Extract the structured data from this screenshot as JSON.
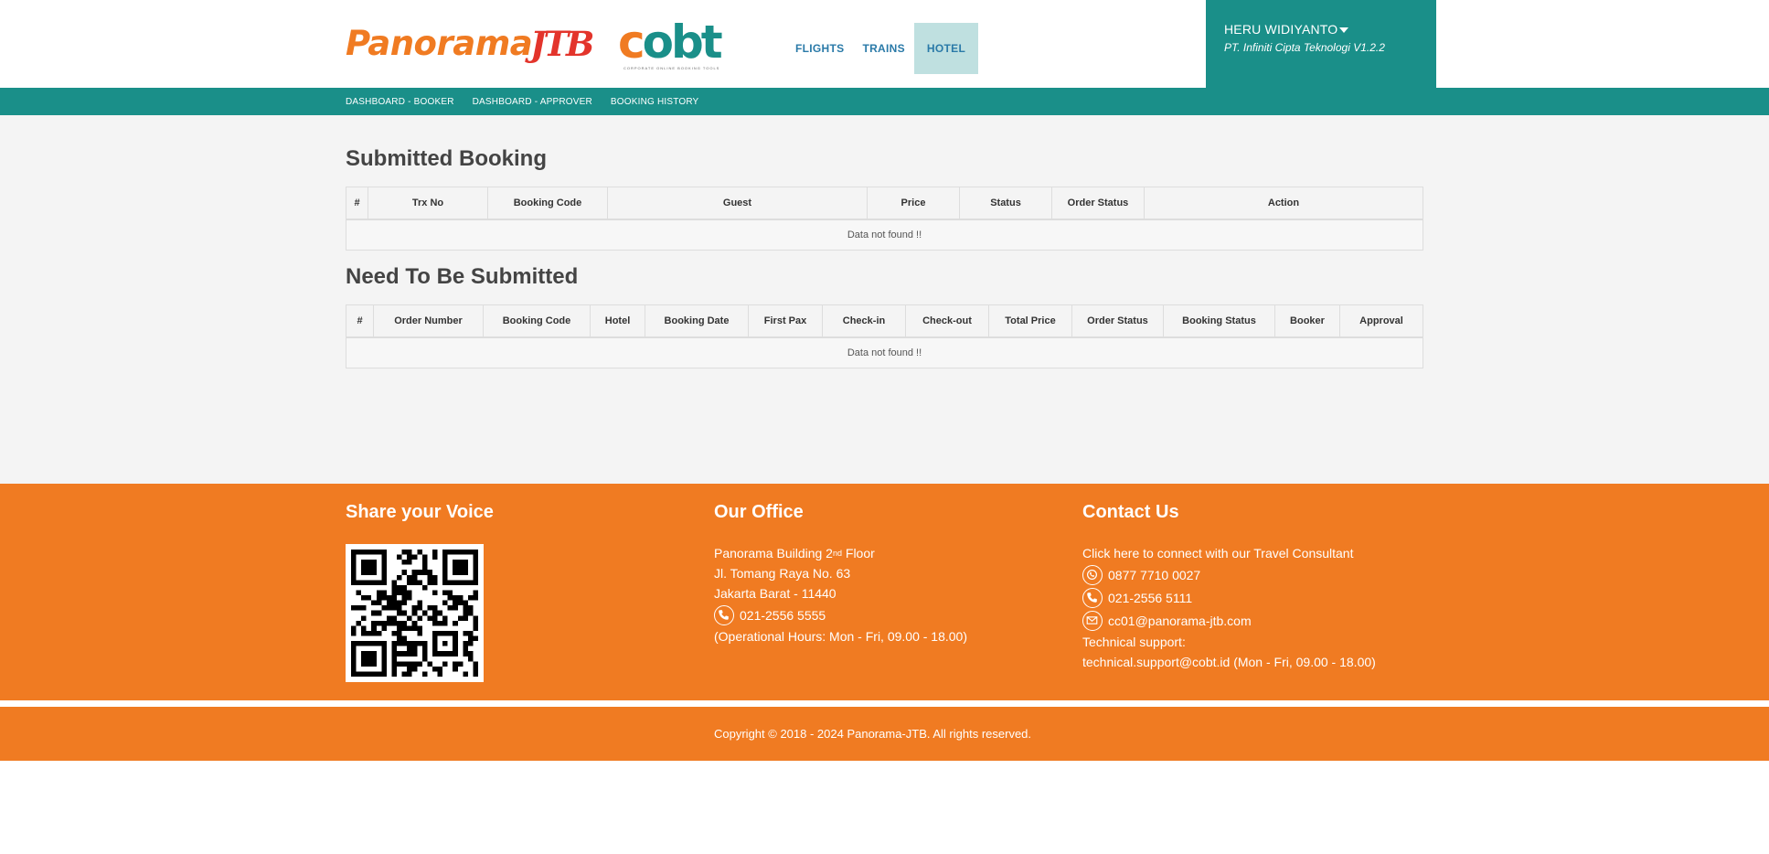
{
  "header": {
    "logo_panorama_text": "Panorama",
    "logo_jtb_text": "JTB",
    "logo_cobt_text": "cobt",
    "logo_cobt_tagline": "CORPORATE ONLINE BOOKING TOOLS",
    "nav": [
      {
        "label": "FLIGHTS",
        "active": false
      },
      {
        "label": "TRAINS",
        "active": false
      },
      {
        "label": "HOTEL",
        "active": true
      }
    ],
    "user": {
      "name": "HERU WIDIYANTO",
      "company": "PT. Infiniti Cipta Teknologi V1.2.2"
    },
    "colors": {
      "teal": "#1a8f89",
      "orange": "#f07b22",
      "red": "#e3342b",
      "nav_active_bg": "#bfe0e0",
      "nav_text": "#2a7aa8"
    }
  },
  "subnav": {
    "items": [
      "DASHBOARD - BOOKER",
      "DASHBOARD - APPROVER",
      "BOOKING HISTORY"
    ]
  },
  "submitted": {
    "title": "Submitted Booking",
    "columns": [
      "#",
      "Trx No",
      "Booking Code",
      "Guest",
      "Price",
      "Status",
      "Order Status",
      "Action"
    ],
    "empty_text": "Data not found !!"
  },
  "pending": {
    "title": "Need To Be Submitted",
    "columns": [
      "#",
      "Order Number",
      "Booking Code",
      "Hotel",
      "Booking Date",
      "First Pax",
      "Check-in",
      "Check-out",
      "Total Price",
      "Order Status",
      "Booking Status",
      "Booker",
      "Approval"
    ],
    "empty_text": "Data not found !!"
  },
  "footer": {
    "voice": {
      "title": "Share your Voice"
    },
    "office": {
      "title": "Our Office",
      "building": "Panorama Building 2",
      "building_sup": "nd",
      "building_floor": " Floor",
      "street": "Jl. Tomang Raya No. 63",
      "city": "Jakarta Barat - 11440",
      "phone": "021-2556 5555",
      "hours": "(Operational Hours: Mon - Fri, 09.00 - 18.00)"
    },
    "contact": {
      "title": "Contact Us",
      "link": "Click here to connect with our Travel Consultant",
      "whatsapp": "0877 7710 0027",
      "phone": "021-2556 5111",
      "email": "cc01@panorama-jtb.com",
      "support_label": "Technical support:",
      "support_text": "technical.support@cobt.id (Mon - Fri, 09.00 - 18.00)"
    }
  },
  "copyright": "Copyright © 2018 - 2024 Panorama-JTB. All rights reserved."
}
